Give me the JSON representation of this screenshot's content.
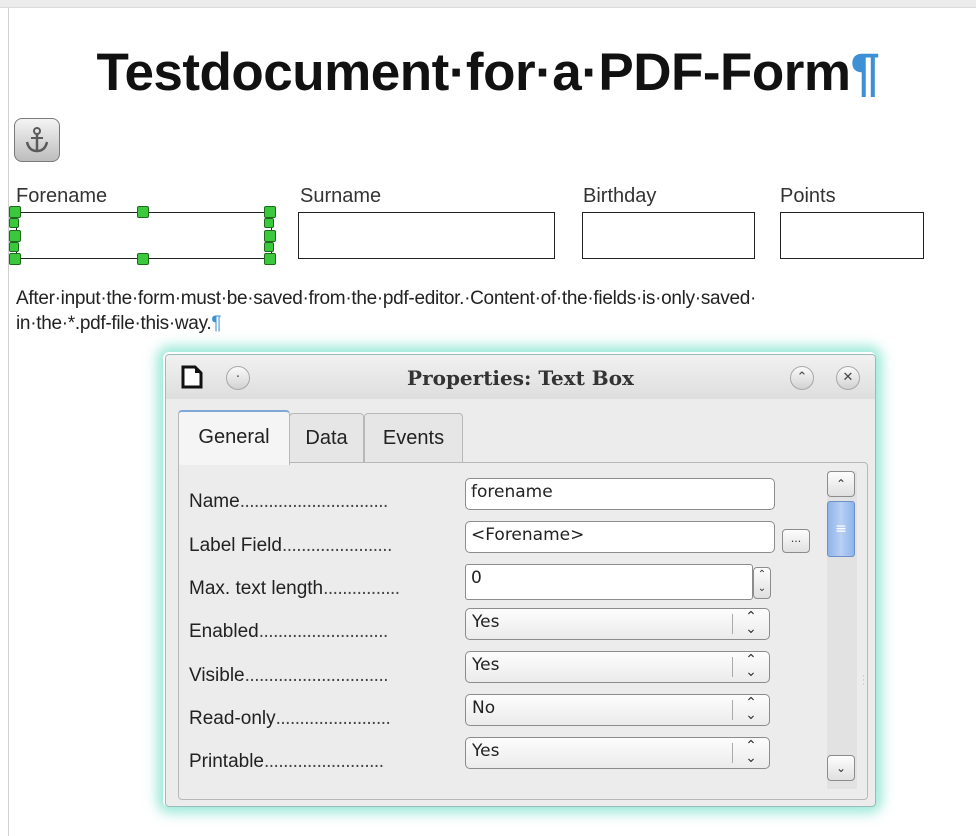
{
  "document": {
    "title": "Testdocument·for·a·PDF-Form",
    "pilcrow": "¶",
    "fields": [
      {
        "label": "Forename"
      },
      {
        "label": "Surname"
      },
      {
        "label": "Birthday"
      },
      {
        "label": "Points"
      }
    ],
    "paragraph_line1": "After·input·the·form·must·be·saved·from·the·pdf-editor.·Content·of·the·fields·is·only·saved·",
    "paragraph_line2": "in·the·*.pdf-file·this·way.",
    "paragraph_pilcrow": "¶"
  },
  "dialog": {
    "title": "Properties: Text Box",
    "tabs": [
      "General",
      "Data",
      "Events"
    ],
    "active_tab": "General",
    "properties": [
      {
        "label": "Name",
        "dots": "...............................",
        "type": "text",
        "value": "forename"
      },
      {
        "label": "Label Field",
        "dots": ".......................",
        "type": "text",
        "value": "<Forename>"
      },
      {
        "label": "Max. text length",
        "dots": "................",
        "type": "spin",
        "value": "0"
      },
      {
        "label": "Enabled",
        "dots": "...........................",
        "type": "select",
        "value": "Yes"
      },
      {
        "label": "Visible",
        "dots": "..............................",
        "type": "select",
        "value": "Yes"
      },
      {
        "label": "Read-only",
        "dots": "........................",
        "type": "select",
        "value": "No"
      },
      {
        "label": "Printable",
        "dots": ".........................",
        "type": "select",
        "value": "Yes"
      }
    ],
    "browse_label": "...",
    "colors": {
      "accent_glow": "#48d6b8",
      "pilcrow": "#3d8fd6",
      "handle": "#3cc83c"
    }
  }
}
